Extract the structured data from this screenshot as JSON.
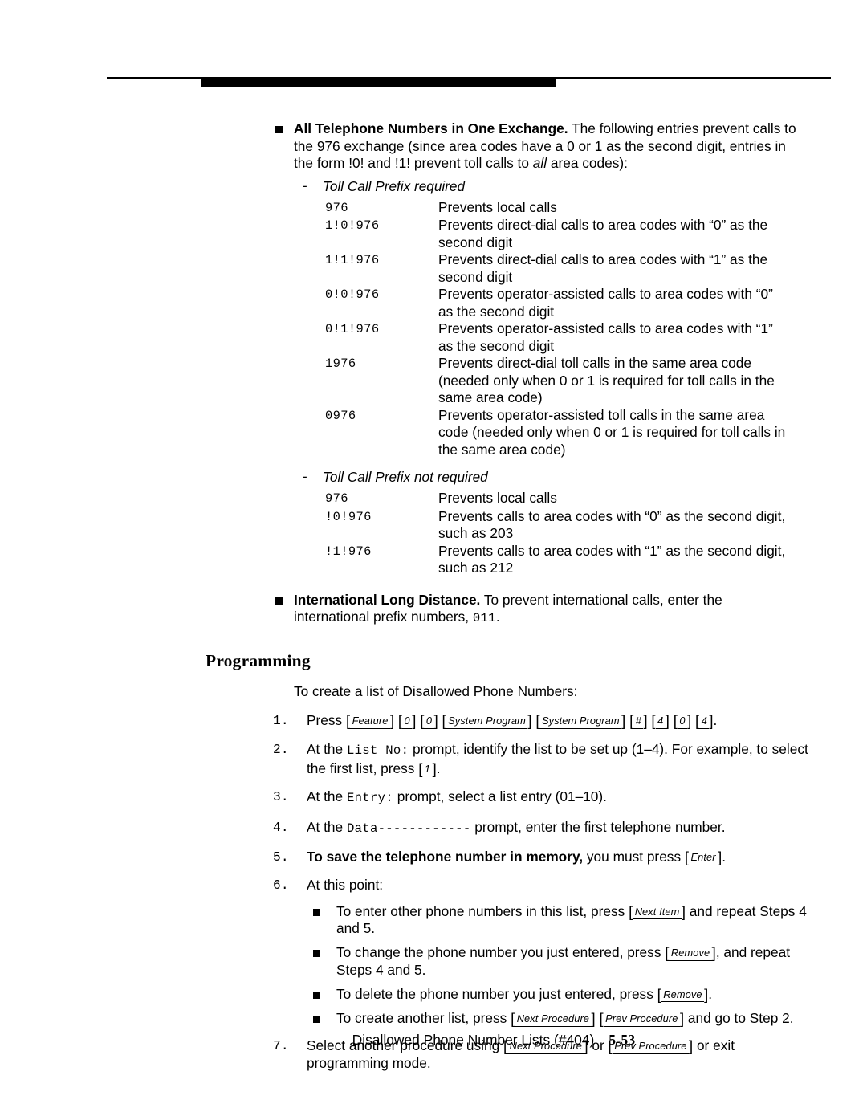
{
  "document": {
    "footer": {
      "title": "Disallowed Phone Number Lists (#404)",
      "page_number": "5-53"
    }
  },
  "bullets": {
    "all_telephone_numbers": {
      "title": "All Telephone Numbers in One Exchange.",
      "text_1": " The following entries prevent calls to the 976 exchange (since area codes have a 0 or 1 as the second digit, entries in the form !0! and !1! prevent toll calls to ",
      "emphasis": "all",
      "text_2": " area codes):"
    },
    "international": {
      "title": "International Long Distance.",
      "text_1": " To prevent international calls, enter the international prefix numbers, ",
      "code": "011",
      "text_2": "."
    }
  },
  "prefix_required": {
    "heading": "Toll Call Prefix required",
    "dash": "-",
    "rows": [
      {
        "code": "976",
        "desc": "Prevents local calls"
      },
      {
        "code": "1!0!976",
        "desc": "Prevents direct-dial calls to area codes with “0” as the second digit"
      },
      {
        "code": "1!1!976",
        "desc": "Prevents direct-dial calls to area codes with “1” as the second digit"
      },
      {
        "code": "0!0!976",
        "desc": "Prevents operator-assisted calls to area codes with “0” as the second digit"
      },
      {
        "code": "0!1!976",
        "desc": "Prevents operator-assisted calls to area codes with “1” as the second digit"
      },
      {
        "code": "1976",
        "desc": "Prevents direct-dial toll calls in the same area code (needed only when 0 or 1 is required for toll calls in the same area code)"
      },
      {
        "code": "0976",
        "desc": "Prevents operator-assisted toll calls in the same area code (needed only when 0 or 1 is required for toll calls in the same area code)"
      }
    ]
  },
  "prefix_not_required": {
    "heading": "Toll Call Prefix not required",
    "dash": "-",
    "rows": [
      {
        "code": "976",
        "desc": "Prevents local calls"
      },
      {
        "code": "!0!976",
        "desc": "Prevents calls to area codes with “0” as the second digit, such as 203"
      },
      {
        "code": "!1!976",
        "desc": "Prevents calls to area codes with “1” as the second digit, such as 212"
      }
    ]
  },
  "programming": {
    "heading": "Programming",
    "lead_in": "To create a list of Disallowed Phone Numbers:",
    "steps": {
      "step1": {
        "num": "1.",
        "text_1": "Press ",
        "keys": [
          "Feature",
          "0",
          "0",
          "System Program",
          "System Program",
          "#",
          "4",
          "0",
          "4"
        ],
        "text_2": "."
      },
      "step2": {
        "num": "2.",
        "text_1": "At the ",
        "code": "List No:",
        "text_2": " prompt, identify the list to be set up (1–4). For example, to select the first list, press ",
        "key": "1",
        "text_3": "."
      },
      "step3": {
        "num": "3.",
        "text_1": "At the ",
        "code": "Entry:",
        "text_2": " prompt, select a list entry (01–10)."
      },
      "step4": {
        "num": "4.",
        "text_1": "At the ",
        "code": "Data------------",
        "text_2": " prompt, enter the first telephone number."
      },
      "step5": {
        "num": "5.",
        "bold_text": "To save the telephone number in memory,",
        "text_1": " you must press ",
        "key": "Enter",
        "text_2": "."
      },
      "step6": {
        "num": "6.",
        "text_1": "At this point:",
        "sub_bullets": [
          {
            "text_1": "To enter other phone numbers in this list, press ",
            "keys": [
              "Next Item"
            ],
            "text_2": " and repeat Steps 4 and 5."
          },
          {
            "text_1": "To change the phone number you just entered, press ",
            "keys": [
              "Remove"
            ],
            "text_2": ", and repeat Steps 4 and 5."
          },
          {
            "text_1": "To delete the phone number you just entered, press ",
            "keys": [
              "Remove"
            ],
            "text_2": "."
          },
          {
            "text_1": "To create another list, press ",
            "keys": [
              "Next Procedure",
              "Prev Procedure"
            ],
            "text_2": " and go to Step 2."
          }
        ]
      },
      "step7": {
        "num": "7.",
        "text_1": "Select another procedure using ",
        "key_1": "Next Procedure",
        "text_2": " or ",
        "key_2": "Prev Procedure",
        "text_3": " or exit programming  mode."
      }
    }
  }
}
